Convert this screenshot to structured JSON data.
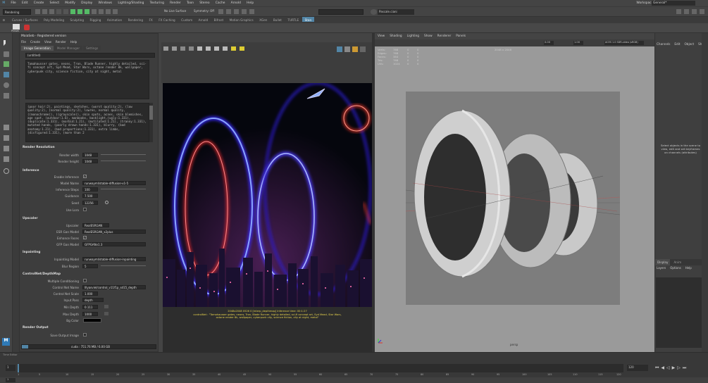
{
  "menubar": {
    "items": [
      "File",
      "Edit",
      "Create",
      "Select",
      "Modify",
      "Display",
      "Windows",
      "Lighting/Shading",
      "Texturing",
      "Render",
      "Toon",
      "Stereo",
      "Cache",
      "Arnold",
      "Help"
    ],
    "workspace_label": "Workspace:",
    "workspace_value": "General*"
  },
  "toolbar": {
    "mode_select": "Rendering",
    "no_live": "No Live Surface",
    "symmetry": "Symmetry: Off",
    "login": "Pascale.ciani"
  },
  "shelf": {
    "tabs": [
      "Curves / Surfaces",
      "Poly Modeling",
      "Sculpting",
      "Rigging",
      "Animation",
      "Rendering",
      "FX",
      "FX Caching",
      "Custom",
      "Arnold",
      "Bifrost",
      "Motion Graphics",
      "XGen",
      "Bullet",
      "TURTLE",
      "Stan"
    ],
    "stan_label": "Preset"
  },
  "plugin": {
    "title": "MaiaSeb - Registered version",
    "menu": [
      "File",
      "Create",
      "View",
      "Render",
      "Help"
    ],
    "tabs": [
      "Image Generation",
      "Model Manager",
      "Settings"
    ],
    "preset": "(untitled)",
    "prompt": "Tamahausser gates, neons, Tron, Blade Runner, highly detailed, sci-fi concept art, Syd Mead, Star Wars, octane render 8k, wallpaper, cyberpunk city, science fiction, city at night, metal",
    "negative": "(poor hair:2), paintings, sketches, (worst quality:2), (low quality:2), (normal quality:2), lowres, normal quality, ((monochrome)), ((grayscale)), skin spots, acnes, skin blemishes, age spot, (outdoor:1.6), manboobs, backlight,(ugly:1.331), (duplicate:1.331), (morbid:1.21), (mutilated:1.21), (tranny:1.331), mutated hands, (poorly drawn hands:1.331), blurry, (bad anatomy:1.21), (bad proportions:1.331), extra limbs, (disfigured:1.331), (more than 2",
    "sections": {
      "render_resolution": "Render Resolution",
      "width_label": "Render width",
      "width": "1048",
      "height_label": "Render height",
      "height": "1048",
      "inference": "Inference",
      "enable_label": "Enable Inference",
      "model_label": "Model Name",
      "model": "runwayml/stable-diffusion-v1-5",
      "steps_label": "Inference Steps",
      "steps": "100",
      "guidance_label": "Guidance",
      "guidance": "7.500",
      "seed_label": "Seed",
      "seed": "12256",
      "use_lora_label": "Use Lora",
      "upscaler": "Upscaler",
      "upscaler_label": "Upscaler",
      "upscaler_value": "RealESRGAN",
      "esr_label": "ESR Gan Model",
      "esr_value": "RealESRGAN_x2plus",
      "enhance_label": "Enhance Faces",
      "gfp_label": "GFP Gan Model",
      "gfp_value": "GFPGANv1.3",
      "inpainting": "Inpainting",
      "inpaint_label": "Inpainting Model",
      "inpaint_value": "runwayml/stable-diffusion-inpainting",
      "blur_label": "Blur Region",
      "blur": "5",
      "controlnet": "ControlNet/DepthMap",
      "multi_label": "Multiple Conditioning",
      "cnname_label": "Control Net Name",
      "cnname_value": "lllyasviel/control_v11f1p_sd15_depth",
      "cnscale_label": "Control Net Scale",
      "cnscale": "1.000",
      "input_label": "Input Pass",
      "input_value": "depth",
      "min_label": "Min Depth",
      "min": "0.111",
      "max_label": "Max Depth",
      "max": "1000",
      "bg_label": "Bg Color",
      "render_output": "Render Output",
      "save_label": "Save Output Image"
    },
    "status": "cuda : 751.76 MB / 6.00 GB"
  },
  "viewA": {
    "caption": "2048x2048 0526 0 [interp_depthmap] Inference time: 00:1:27\ncontrolNet : \"Tamahausser gates, neons, Tron, Blade Runner, highly detailed, sci-fi concept art, Syd Mead, Star Wars, octane render 8k, wallpaper, cyberpunk city, science fiction, city at night, metal\""
  },
  "viewB": {
    "menu": [
      "View",
      "Shading",
      "Lighting",
      "Show",
      "Renderer",
      "Panels"
    ],
    "stats_labels": [
      "Verts:",
      "Edges:",
      "Faces:",
      "Tris:",
      "UVs:"
    ],
    "stats_values": [
      [
        "768",
        "0",
        "0"
      ],
      [
        "768",
        "0",
        "0"
      ],
      [
        "384",
        "0",
        "0"
      ],
      [
        "768",
        "0",
        "0"
      ],
      [
        "1024",
        "0",
        "0"
      ]
    ],
    "resolution": "2048 x 2048",
    "aces": "ACES 1.0 SDR-video (sRGB)",
    "camera": "persp",
    "fields": [
      "0.00",
      "1.00"
    ]
  },
  "channel_box": {
    "tabs": [
      "Channels",
      "Edit",
      "Object",
      "Show"
    ],
    "hint": "Select objects in the scene to view, edit and set keyframes on channels (attributes)",
    "display_tab": "Display",
    "anim_tab": "Anim",
    "display_menu": [
      "Layers",
      "Options",
      "Help"
    ]
  },
  "timeline": {
    "start": "1",
    "end": "120",
    "current": "1",
    "frames": [
      "1",
      "5",
      "10",
      "15",
      "20",
      "25",
      "30",
      "35",
      "40",
      "45",
      "50",
      "55",
      "60",
      "65",
      "70",
      "75",
      "80",
      "85",
      "90",
      "95",
      "100",
      "105",
      "110",
      "115",
      "120"
    ]
  },
  "colors": {
    "bg": "#444444",
    "panel": "#3d3d3d",
    "accent": "#5285a6",
    "viewport": "#9a9a9a"
  }
}
